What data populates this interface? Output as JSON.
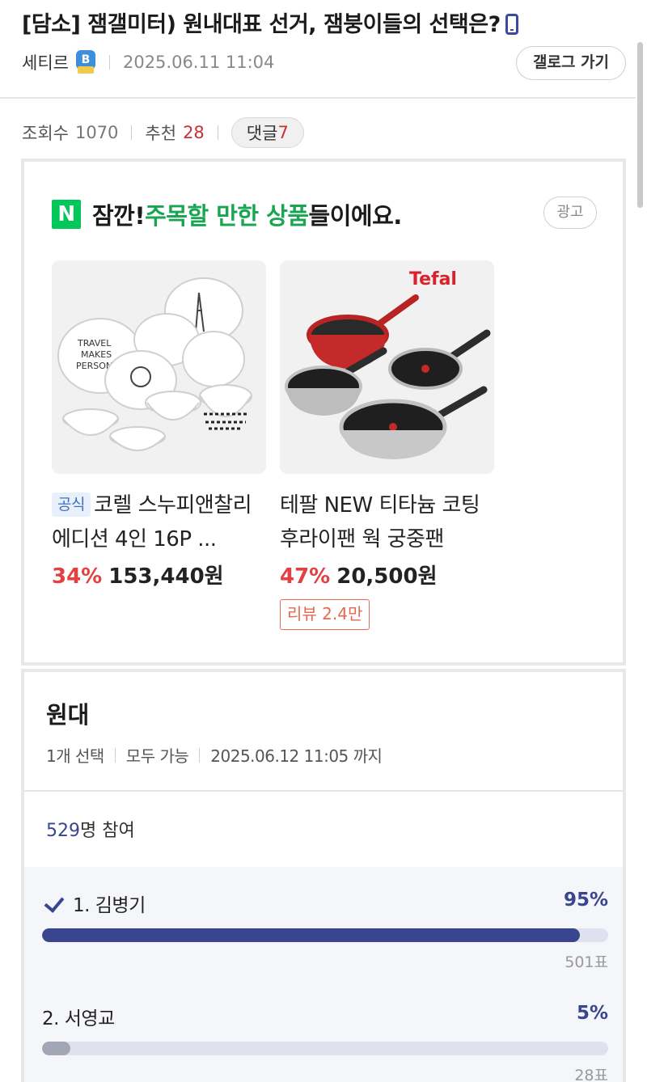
{
  "post": {
    "title": "[담소] 잼갤미터) 원내대표 선거, 잼붕이들의 선택은?",
    "author": "세티르",
    "badge_letter": "B",
    "date": "2025.06.11 11:04",
    "gallery_button": "갤로그 가기",
    "icons": {
      "device": "mobile-phone-icon",
      "badge": "member-badge-icon"
    }
  },
  "stats": {
    "views_label": "조회수",
    "views": "1070",
    "recommend_label": "추천",
    "recommend": "28",
    "comments_label": "댓글",
    "comments": "7"
  },
  "ad": {
    "logo_letter": "N",
    "heading_prefix": "잠깐! ",
    "heading_highlight": "주목할 만한 상품",
    "heading_suffix": "들이에요.",
    "ad_label": "광고",
    "highlight_color": "#1aa552",
    "products": [
      {
        "official_tag": "공식",
        "name": "코렐 스누피앤찰리에디션 4인 16P ...",
        "discount": "34%",
        "price": "153,440원",
        "image": "snoopy-dinnerware-set-image"
      },
      {
        "name": "테팔 NEW 티타늄 코팅 후라이팬 웍 궁중팬",
        "discount": "47%",
        "price": "20,500원",
        "review": "리뷰 2.4만",
        "brand_mark": "Tefal",
        "image": "tefal-frying-pans-image"
      }
    ]
  },
  "poll": {
    "title": "원대",
    "selection": "1개 선택",
    "visibility": "모두 가능",
    "deadline": "2025.06.12 11:05 까지",
    "participants_count": "529",
    "participants_suffix": "명 참여",
    "accent_color": "#3a4590",
    "options": [
      {
        "label": "1. 김병기",
        "percent": "95%",
        "votes": "501표",
        "fraction": 0.95,
        "selected": true
      },
      {
        "label": "2. 서영교",
        "percent": "5%",
        "votes": "28표",
        "fraction": 0.05,
        "selected": false
      }
    ]
  }
}
